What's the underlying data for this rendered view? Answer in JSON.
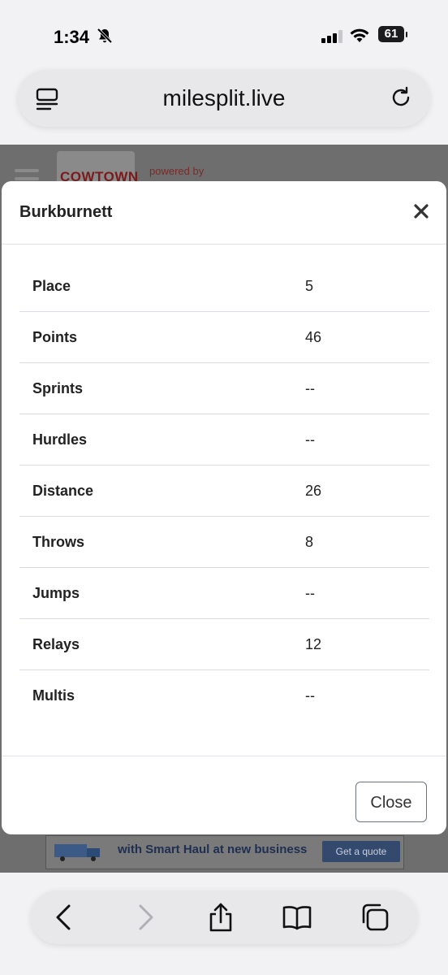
{
  "status_bar": {
    "time": "1:34",
    "battery": "61"
  },
  "browser": {
    "url": "milesplit.live"
  },
  "background_page": {
    "logo_text": "COWTOWN",
    "powered_by": "powered by",
    "ad_text": "with Smart Haul at new business",
    "ad_button": "Get a quote"
  },
  "modal": {
    "title": "Burkburnett",
    "rows": [
      {
        "label": "Place",
        "value": "5"
      },
      {
        "label": "Points",
        "value": "46"
      },
      {
        "label": "Sprints",
        "value": "--"
      },
      {
        "label": "Hurdles",
        "value": "--"
      },
      {
        "label": "Distance",
        "value": "26"
      },
      {
        "label": "Throws",
        "value": "8"
      },
      {
        "label": "Jumps",
        "value": "--"
      },
      {
        "label": "Relays",
        "value": "12"
      },
      {
        "label": "Multis",
        "value": "--"
      }
    ],
    "close_label": "Close"
  },
  "toolbar": {
    "icons": [
      "back-icon",
      "forward-icon",
      "share-icon",
      "bookmarks-icon",
      "tabs-icon"
    ]
  }
}
